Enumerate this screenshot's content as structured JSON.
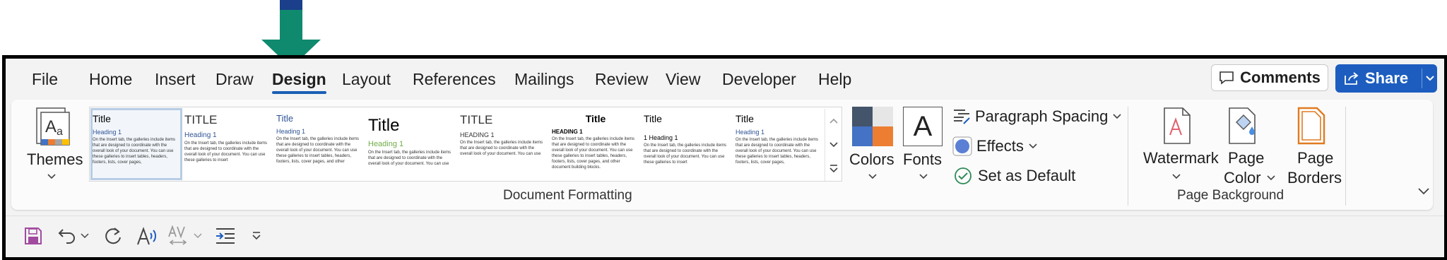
{
  "tabs": [
    "File",
    "Home",
    "Insert",
    "Draw",
    "Design",
    "Layout",
    "References",
    "Mailings",
    "Review",
    "View",
    "Developer",
    "Help"
  ],
  "active_tab": "Design",
  "comments_label": "Comments",
  "share_label": "Share",
  "themes_label": "Themes",
  "style_set": [
    {
      "title": "Title",
      "heading": "Heading 1",
      "body": "On the Insert tab, the galleries include items that are designed to coordinate with the overall look of your document. You can use these galleries to insert tables, headers, footers, lists, cover pages,"
    },
    {
      "title": "TITLE",
      "heading": "Heading 1",
      "body": "On the Insert tab, the galleries include items that are designed to coordinate with the overall look of your document. You can use these galleries to insert"
    },
    {
      "title": "Title",
      "heading": "Heading 1",
      "body": "On the Insert tab, the galleries include items that are designed to coordinate with the overall look of your document. You can use these galleries to insert tables, headers, footers, lists, cover pages, and other"
    },
    {
      "title": "Title",
      "heading": "Heading 1",
      "body": "On the Insert tab, the galleries include items that are designed to coordinate with the overall look of your document. You can use"
    },
    {
      "title": "TITLE",
      "heading": "HEADING 1",
      "body": "On the Insert tab, the galleries include items that are designed to coordinate with the overall look of your document. You can use"
    },
    {
      "title": "Title",
      "heading": "HEADING 1",
      "body": "On the Insert tab, the galleries include items that are designed to coordinate with the overall look of your document. You can use these galleries to insert tables, headers, footers, lists, cover pages, and other document building blocks."
    },
    {
      "title": "Title",
      "heading": "1  Heading 1",
      "body": "On the Insert tab, the galleries include items that are designed to coordinate with the overall look of your document. You can use these galleries to insert"
    },
    {
      "title": "Title",
      "heading": "Heading 1",
      "body": "On the Insert tab, the galleries include items that are designed to coordinate with the overall look of your document. You can use these galleries to insert tables, headers, footers, lists, cover pages,"
    }
  ],
  "colors_label": "Colors",
  "fonts_label": "Fonts",
  "fonts_glyph": "A",
  "paragraph_spacing_label": "Paragraph Spacing",
  "effects_label": "Effects",
  "set_default_label": "Set as Default",
  "document_formatting_label": "Document Formatting",
  "watermark_label": "Watermark",
  "page_color_label": [
    "Page",
    "Color"
  ],
  "page_borders_label": [
    "Page",
    "Borders"
  ],
  "page_background_label": "Page Background",
  "colors": {
    "accent": "#1d5dbf",
    "arrow": "#0f8a6e",
    "swatch": [
      "#44546a",
      "#e7e6e6",
      "#4472c4",
      "#ed7d31"
    ]
  }
}
